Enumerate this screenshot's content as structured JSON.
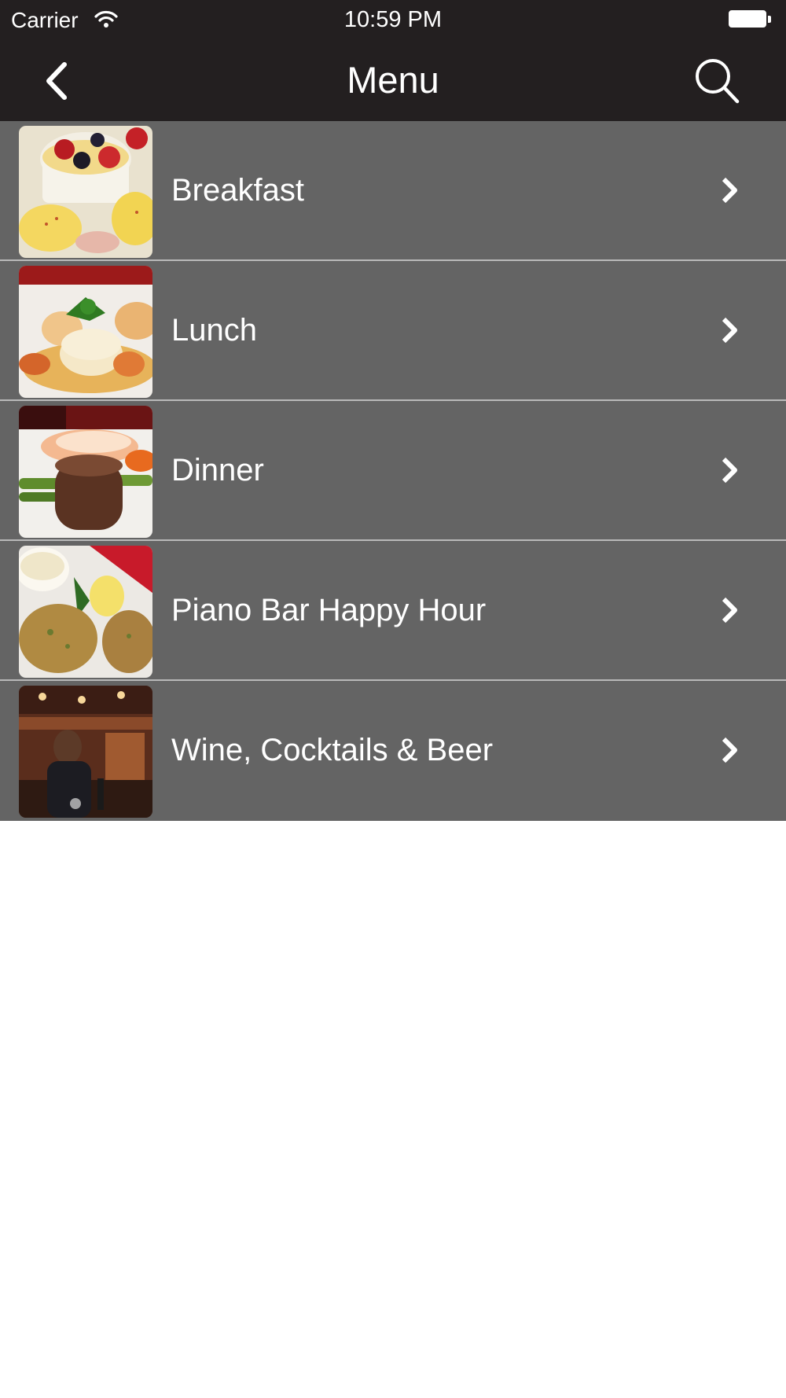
{
  "status_bar": {
    "carrier": "Carrier",
    "time": "10:59 PM",
    "icons": [
      "wifi-icon",
      "battery-icon"
    ]
  },
  "nav": {
    "title": "Menu",
    "back_icon": "chevron-left-icon",
    "search_icon": "search-icon"
  },
  "menu_items": [
    {
      "label": "Breakfast",
      "thumbnail": "breakfast-photo"
    },
    {
      "label": "Lunch",
      "thumbnail": "lunch-photo"
    },
    {
      "label": "Dinner",
      "thumbnail": "dinner-photo"
    },
    {
      "label": "Piano Bar Happy Hour",
      "thumbnail": "happy-hour-photo"
    },
    {
      "label": "Wine, Cocktails & Beer",
      "thumbnail": "bar-photo"
    }
  ],
  "colors": {
    "bar_background": "#231f20",
    "row_background": "#646464",
    "row_divider": "#b9b9b9",
    "text": "#ffffff",
    "page_background": "#ffffff"
  }
}
